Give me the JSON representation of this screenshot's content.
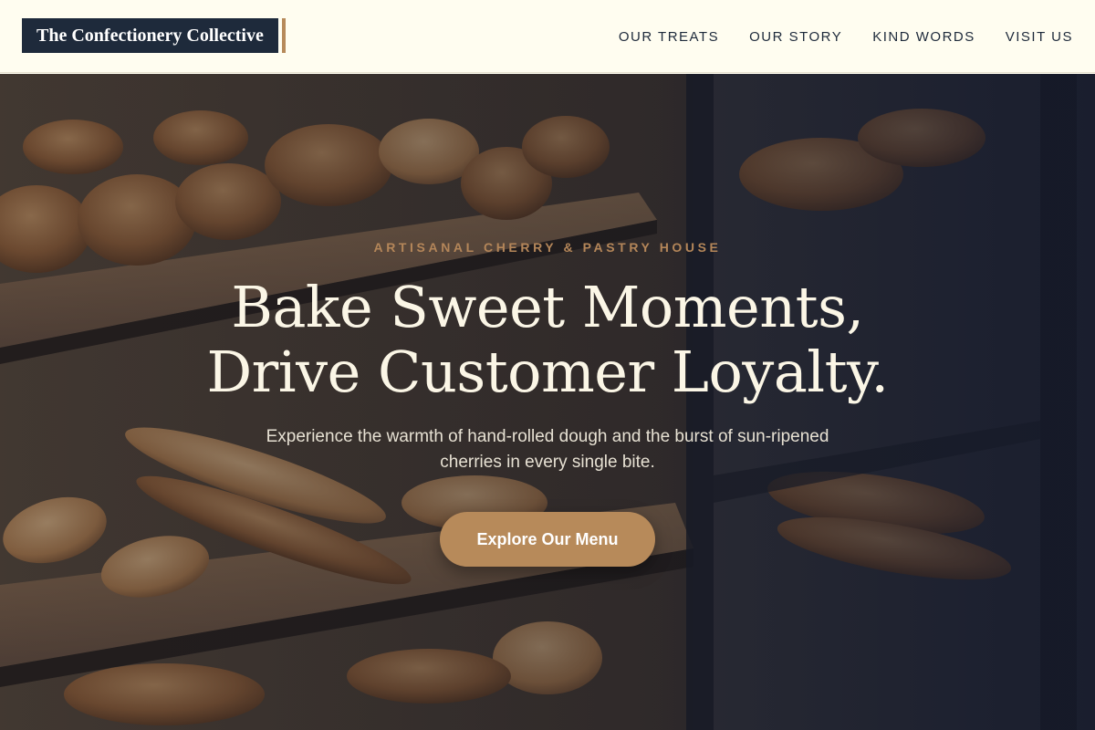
{
  "brand": {
    "logo_text": "The Confectionery Collective"
  },
  "nav": {
    "items": [
      {
        "label": "OUR TREATS"
      },
      {
        "label": "OUR STORY"
      },
      {
        "label": "KIND WORDS"
      },
      {
        "label": "VISIT US"
      }
    ]
  },
  "hero": {
    "eyebrow": "ARTISANAL CHERRY & PASTRY HOUSE",
    "headline_line1": "Bake Sweet Moments,",
    "headline_line2": "Drive Customer Loyalty.",
    "subtext": "Experience the warmth of hand-rolled dough and the burst of sun-ripened cherries in every single bite.",
    "cta_label": "Explore Our Menu"
  },
  "colors": {
    "nav_bg": "#fffdf0",
    "navy": "#1e2a3b",
    "accent": "#b78a5a",
    "headline": "#fbf6e6"
  }
}
